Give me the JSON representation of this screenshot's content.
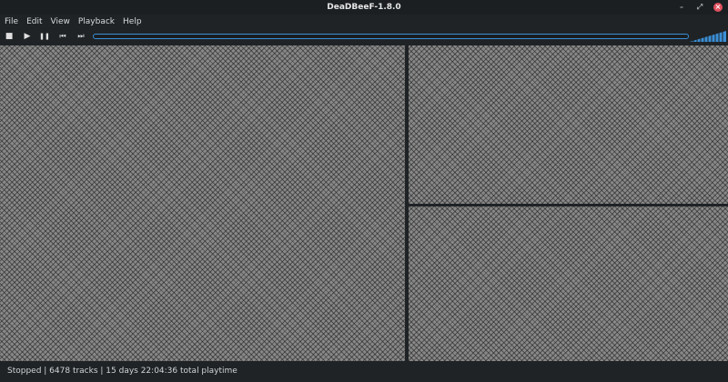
{
  "window": {
    "title": "DeaDBeeF-1.8.0"
  },
  "menu": [
    "File",
    "Edit",
    "View",
    "Playback",
    "Help"
  ],
  "toolbar": {
    "stop": "■",
    "play": "▶",
    "pause": "❚❚",
    "prev": "⏮",
    "next": "⏭"
  },
  "status": "Stopped | 6478 tracks | 15 days 22:04:36 total playtime",
  "colors": {
    "accent": "#3a8fd8",
    "close": "#e0505e"
  }
}
